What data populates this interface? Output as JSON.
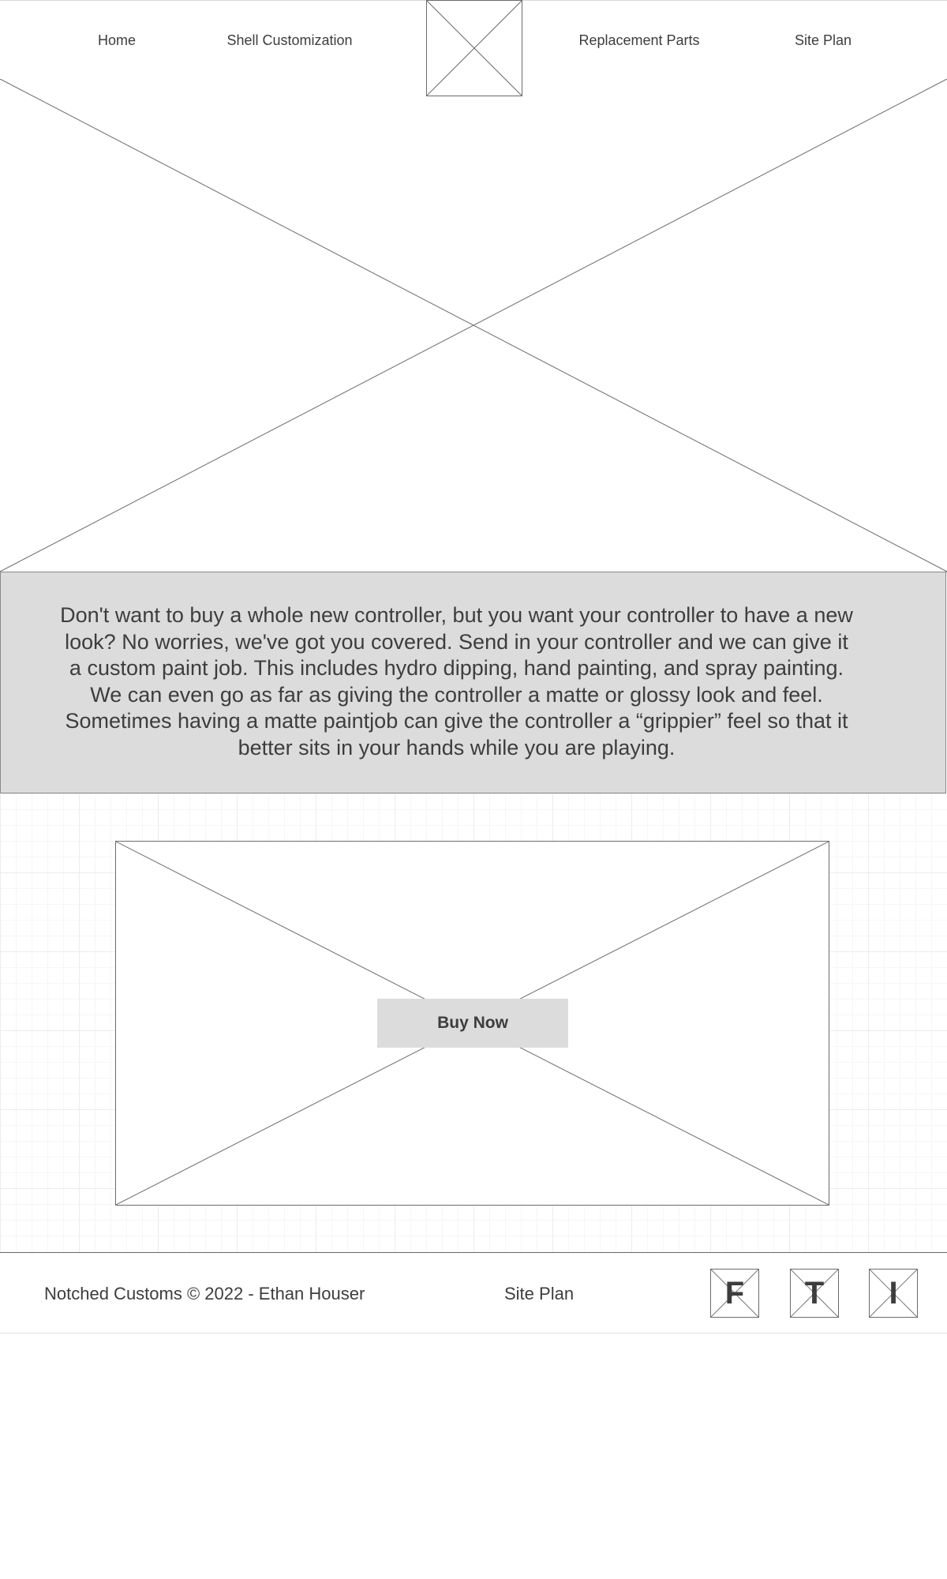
{
  "nav": {
    "home": "Home",
    "shell_customization": "Shell Customization",
    "replacement_parts": "Replacement Parts",
    "site_plan": "Site Plan"
  },
  "intro": {
    "text": "Don't want to buy a whole new controller, but you want your controller to have a new look? No worries, we've got you covered. Send in your controller and we can give it a custom paint job. This includes hydro dipping, hand painting, and spray painting. We can even go as far as giving the controller a matte or glossy look and feel. Sometimes having a matte paintjob can give the controller a “grippier” feel so that it better sits in your hands while you are playing."
  },
  "product": {
    "buy_label": "Buy Now"
  },
  "footer": {
    "copyright": "Notched Customs © 2022 - Ethan Houser",
    "site_plan": "Site Plan",
    "social": [
      {
        "letter": "F",
        "icon": "facebook-icon"
      },
      {
        "letter": "T",
        "icon": "twitter-icon"
      },
      {
        "letter": "I",
        "icon": "instagram-icon"
      }
    ]
  },
  "colors": {
    "text": "#3d3d3d",
    "band": "#dcdcdc",
    "stroke": "#6b6b6b"
  }
}
